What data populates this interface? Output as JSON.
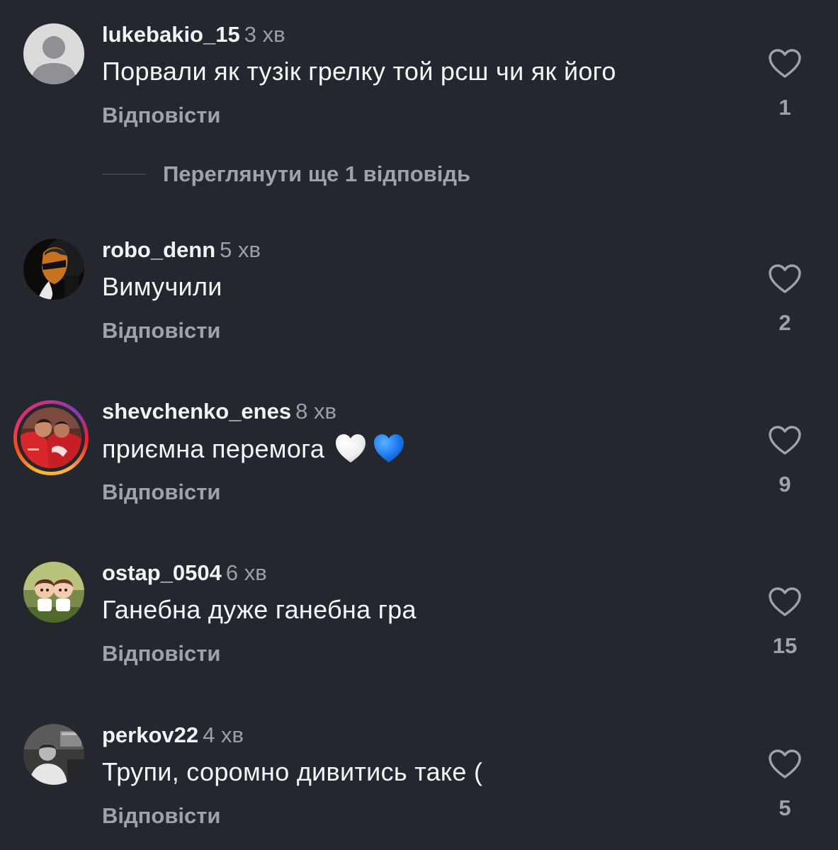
{
  "comments": [
    {
      "username": "lukebakio_15",
      "time": "3 хв",
      "text": "Порвали як тузік грелку той рсш чи як його",
      "reply_label": "Відповісти",
      "likes": "1",
      "avatar": "default-user-avatar"
    },
    {
      "username": "robo_denn",
      "time": "5 хв",
      "text": "Вимучили",
      "reply_label": "Відповісти",
      "likes": "2",
      "avatar": "person-with-sunglasses-photo"
    },
    {
      "username": "shevchenko_enes",
      "time": "8 хв",
      "text": "приємна перемога",
      "emojis": [
        "white-heart",
        "blue-heart"
      ],
      "reply_label": "Відповісти",
      "likes": "9",
      "avatar": "football-players-photo",
      "has_story_ring": true
    },
    {
      "username": "ostap_0504",
      "time": "6 хв",
      "text": "Ганебна дуже ганебна гра",
      "reply_label": "Відповісти",
      "likes": "15",
      "avatar": "cartoon-kids-photo"
    },
    {
      "username": "perkov22",
      "time": "4 хв",
      "text": "Трупи, соромно дивитись таке (",
      "reply_label": "Відповісти",
      "likes": "5",
      "avatar": "person-in-room-photo"
    }
  ],
  "view_more_replies": "Переглянути ще 1 відповідь",
  "colors": {
    "background": "#24272e",
    "primary_text": "#f2f3f5",
    "secondary_text": "#9ea3aa",
    "white_heart": "#f4f4f4",
    "blue_heart": "#1e7df0"
  },
  "icons": {
    "like": "heart-outline-icon"
  }
}
